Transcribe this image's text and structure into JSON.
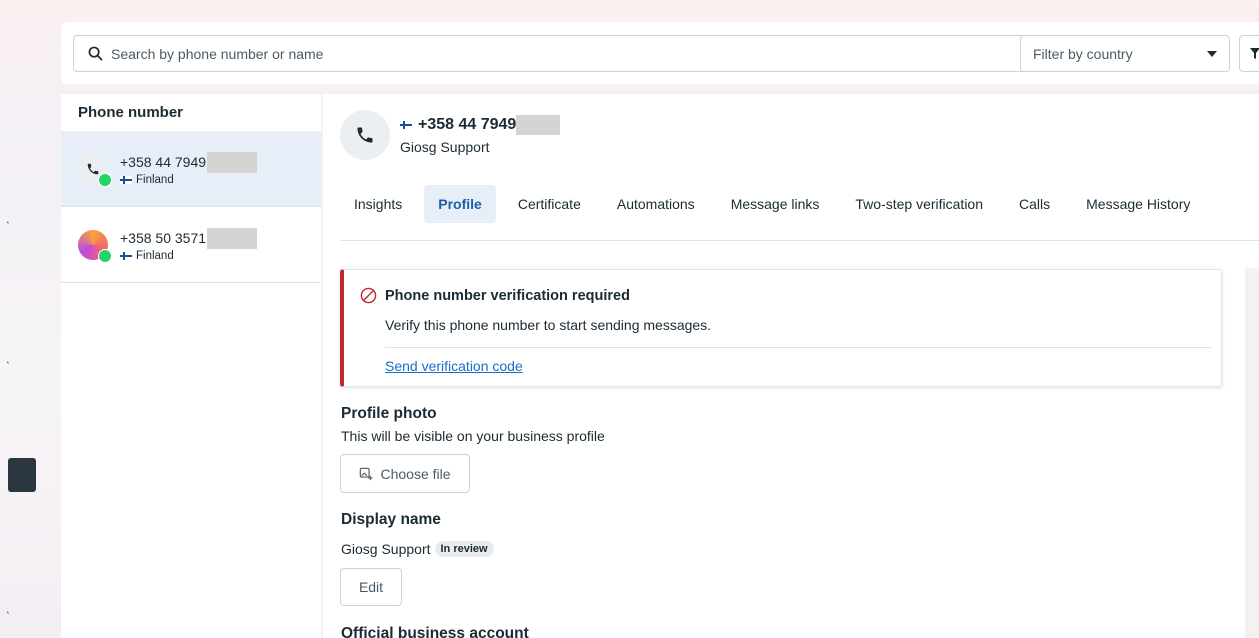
{
  "search": {
    "placeholder": "Search by phone number or name"
  },
  "filter": {
    "country_placeholder": "Filter by country"
  },
  "list": {
    "header": "Phone number",
    "items": [
      {
        "number": "+358 44 7949",
        "country": "Finland"
      },
      {
        "number": "+358 50 3571",
        "country": "Finland"
      }
    ]
  },
  "detail": {
    "number": "+358 44 7949",
    "name": "Giosg Support",
    "tabs": [
      "Insights",
      "Profile",
      "Certificate",
      "Automations",
      "Message links",
      "Two-step verification",
      "Calls",
      "Message History"
    ],
    "active_tab": "Profile",
    "alert": {
      "title": "Phone number verification required",
      "body": "Verify this phone number to start sending messages.",
      "link": "Send verification code"
    },
    "profile_photo": {
      "title": "Profile photo",
      "desc": "This will be visible on your business profile",
      "button": "Choose file"
    },
    "display_name": {
      "title": "Display name",
      "value": "Giosg Support",
      "status": "In review",
      "button": "Edit"
    },
    "official_account": {
      "title": "Official business account"
    }
  },
  "colors": {
    "accent": "#1c5fa8",
    "error": "#c2262e",
    "link": "#1a6ec7",
    "whatsapp": "#25d366"
  }
}
